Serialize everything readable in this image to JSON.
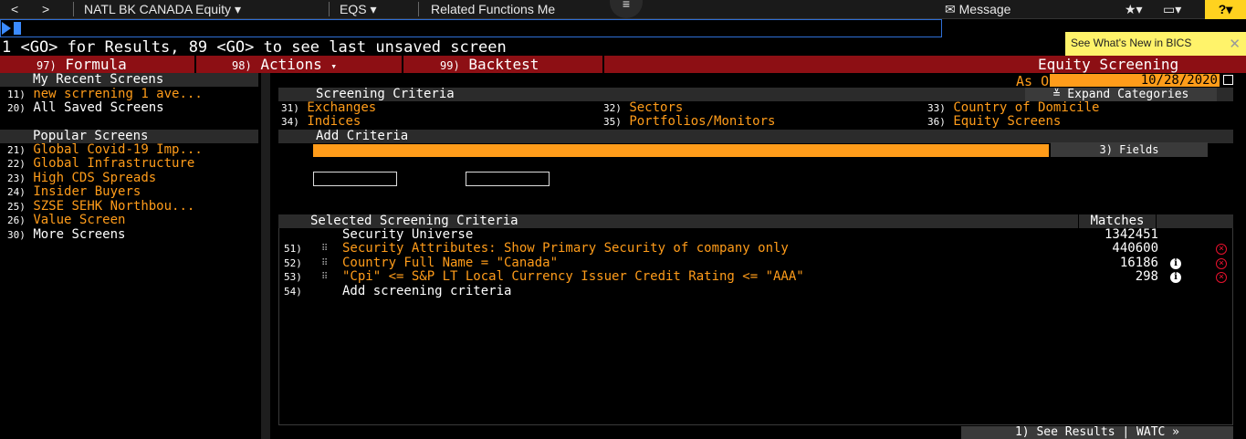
{
  "topbar": {
    "back": "<",
    "forward": ">",
    "security": "NATL BK CANADA Equity",
    "function": "EQS",
    "related": "Related Functions Me",
    "message": "Message"
  },
  "command_line": {
    "value": "",
    "hint": "1 <GO> for Results, 89 <GO> to see last unsaved screen"
  },
  "tooltip": {
    "text": "See What's New in BICS",
    "close": "✕"
  },
  "menu": {
    "formula_num": "97)",
    "formula": "Formula",
    "actions_num": "98)",
    "actions": "Actions",
    "backtest_num": "99)",
    "backtest": "Backtest",
    "title": "Equity Screening"
  },
  "asof": {
    "label": "As Of",
    "date": "10/28/2020"
  },
  "left": {
    "recent_header": "My Recent Screens",
    "recent": [
      {
        "num": "11)",
        "label": "new scrrening 1 ave...",
        "color": "#ff9c1a"
      },
      {
        "num": "20)",
        "label": "All Saved Screens",
        "color": "#ffffff"
      }
    ],
    "popular_header": "Popular Screens",
    "popular": [
      {
        "num": "21)",
        "label": "Global Covid-19 Imp...",
        "color": "#ff9c1a"
      },
      {
        "num": "22)",
        "label": "Global Infrastructure",
        "color": "#ff9c1a"
      },
      {
        "num": "23)",
        "label": "High CDS Spreads",
        "color": "#ff9c1a"
      },
      {
        "num": "24)",
        "label": "Insider Buyers",
        "color": "#ff9c1a"
      },
      {
        "num": "25)",
        "label": "SZSE SEHK Northbou...",
        "color": "#ff9c1a"
      },
      {
        "num": "26)",
        "label": "Value Screen",
        "color": "#ff9c1a"
      },
      {
        "num": "30)",
        "label": "More Screens",
        "color": "#ffffff"
      }
    ]
  },
  "criteria": {
    "header": "Screening Criteria",
    "expand": "≚ Expand Categories",
    "items": [
      {
        "num": "31)",
        "label": "Exchanges"
      },
      {
        "num": "32)",
        "label": "Sectors"
      },
      {
        "num": "33)",
        "label": "Country of Domicile"
      },
      {
        "num": "34)",
        "label": "Indices"
      },
      {
        "num": "35)",
        "label": "Portfolios/Monitors"
      },
      {
        "num": "36)",
        "label": "Equity Screens"
      }
    ],
    "add_header": "Add Criteria",
    "add_input_value": "",
    "fields_button": "3) Fields"
  },
  "selected": {
    "header": "Selected Screening Criteria",
    "matches_header": "Matches",
    "universe_label": "Security Universe",
    "universe_count": "1342451",
    "rows": [
      {
        "num": "51)",
        "label": "Security Attributes: Show Primary Security of company only",
        "count": "440600",
        "info": false
      },
      {
        "num": "52)",
        "label": "Country Full Name = \"Canada\"",
        "count": "16186",
        "info": true
      },
      {
        "num": "53)",
        "label": "\"Cpi\" <= S&P LT Local Currency Issuer Credit Rating <= \"AAA\"",
        "count": "298",
        "info": true
      }
    ],
    "add_num": "54)",
    "add_label": "Add screening criteria"
  },
  "footer": {
    "see_results": "1) See Results | WATC »"
  }
}
